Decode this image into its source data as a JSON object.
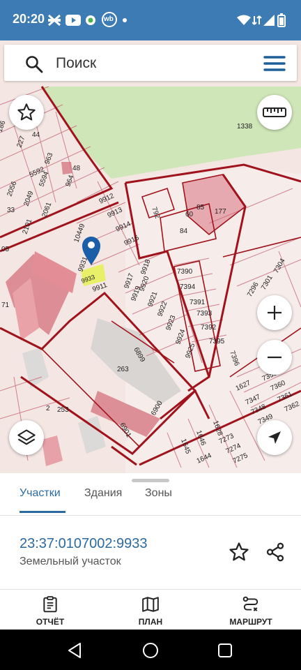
{
  "status_bar": {
    "time": "20:20",
    "icons_left": [
      "x-app-icon",
      "youtube-icon",
      "leaf-icon",
      "wb-icon",
      "dot-icon"
    ],
    "wb_label": "wb",
    "icons_right": [
      "wifi-icon",
      "mobile-signal-4g-icon",
      "signal-icon",
      "battery-icon"
    ]
  },
  "search": {
    "placeholder": "Поиск"
  },
  "map": {
    "parcel_labels": [
      "1338",
      "792",
      "85",
      "177",
      "84",
      "60",
      "7390",
      "7394",
      "7391",
      "7393",
      "7392",
      "7395",
      "7396",
      "7304",
      "7301",
      "7296",
      "9912",
      "9913",
      "9914",
      "9915",
      "10449",
      "9931",
      "9911",
      "9917",
      "9918",
      "9919",
      "9920",
      "9921",
      "9922",
      "9923",
      "9924",
      "9925",
      "263",
      "253",
      "2",
      "6900",
      "6901",
      "6899",
      "1627",
      "1628",
      "1646",
      "1645",
      "1644",
      "7273",
      "7275",
      "7274",
      "7347",
      "7348",
      "7349",
      "7350",
      "7360",
      "7361",
      "7362",
      "227",
      "44",
      "186",
      "5592",
      "5594",
      "963",
      "964",
      "48",
      "2056",
      "2049",
      "2061",
      "2101",
      "33",
      "05",
      "71"
    ],
    "selected_parcel": "9933",
    "accent_color": "#1a5ea8",
    "boundary_color": "#a0121c",
    "highlight_color": "#e8f06a"
  },
  "sheet": {
    "tabs": [
      {
        "label": "Участки",
        "active": true
      },
      {
        "label": "Здания",
        "active": false
      },
      {
        "label": "Зоны",
        "active": false
      }
    ],
    "cadastral_number": "23:37:0107002:9933",
    "object_type": "Земельный участок"
  },
  "bottom_nav": [
    {
      "label": "ОТЧЁТ",
      "icon": "report-icon"
    },
    {
      "label": "ПЛАН",
      "icon": "map-plan-icon"
    },
    {
      "label": "МАРШРУТ",
      "icon": "route-icon"
    }
  ],
  "system_nav": [
    "back-icon",
    "home-icon",
    "recents-icon"
  ]
}
